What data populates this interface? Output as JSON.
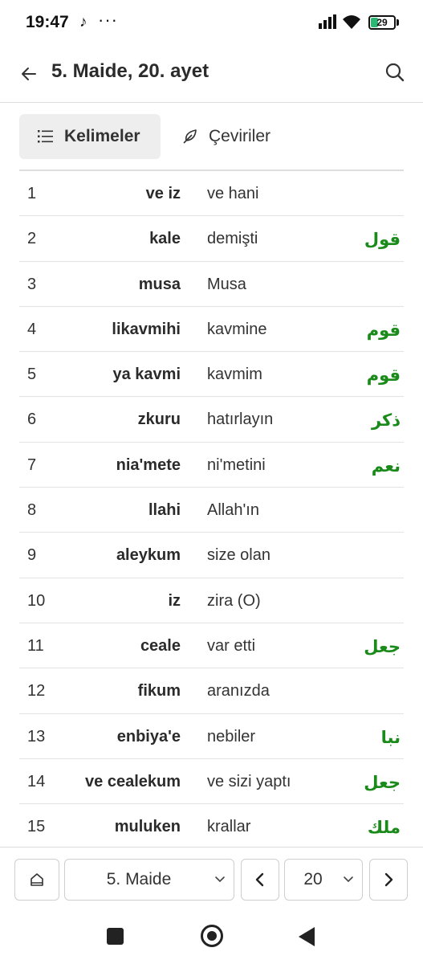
{
  "status_bar": {
    "time": "19:47",
    "tiktok_glyph": "♪",
    "more_dots": "···",
    "battery_level": "29"
  },
  "app_bar": {
    "title": "5. Maide, 20. ayet",
    "back_icon": "arrow-left-icon",
    "search_icon": "search-icon"
  },
  "tabs": [
    {
      "label": "Kelimeler",
      "icon": "list-icon",
      "active": true
    },
    {
      "label": "Çeviriler",
      "icon": "feather-icon",
      "active": false
    }
  ],
  "words": [
    {
      "no": "1",
      "word": "ve iz",
      "meaning": "ve hani",
      "root": ""
    },
    {
      "no": "2",
      "word": "kale",
      "meaning": "demişti",
      "root": "قول"
    },
    {
      "no": "3",
      "word": "musa",
      "meaning": "Musa",
      "root": ""
    },
    {
      "no": "4",
      "word": "likavmihi",
      "meaning": "kavmine",
      "root": "قوم"
    },
    {
      "no": "5",
      "word": "ya kavmi",
      "meaning": "kavmim",
      "root": "قوم"
    },
    {
      "no": "6",
      "word": "zkuru",
      "meaning": "hatırlayın",
      "root": "ذكر"
    },
    {
      "no": "7",
      "word": "nia'mete",
      "meaning": "ni'metini",
      "root": "نعم"
    },
    {
      "no": "8",
      "word": "llahi",
      "meaning": "Allah'ın",
      "root": ""
    },
    {
      "no": "9",
      "word": "aleykum",
      "meaning": "size olan",
      "root": ""
    },
    {
      "no": "10",
      "word": "iz",
      "meaning": "zira (O)",
      "root": ""
    },
    {
      "no": "11",
      "word": "ceale",
      "meaning": "var etti",
      "root": "جعل"
    },
    {
      "no": "12",
      "word": "fikum",
      "meaning": "aranızda",
      "root": ""
    },
    {
      "no": "13",
      "word": "enbiya'e",
      "meaning": "nebiler",
      "root": "نبا"
    },
    {
      "no": "14",
      "word": "ve cealekum",
      "meaning": "ve sizi yaptı",
      "root": "جعل"
    },
    {
      "no": "15",
      "word": "muluken",
      "meaning": "krallar",
      "root": "ملك"
    }
  ],
  "bottom_bar": {
    "home_icon": "home-icon",
    "surah_selected": "5. Maide",
    "prev_icon": "chevron-left-icon",
    "ayah_selected": "20",
    "next_icon": "chevron-right-icon"
  },
  "system_nav": {
    "recents_icon": "square-icon",
    "home_icon": "circle-home-icon",
    "back_icon": "triangle-back-icon"
  }
}
